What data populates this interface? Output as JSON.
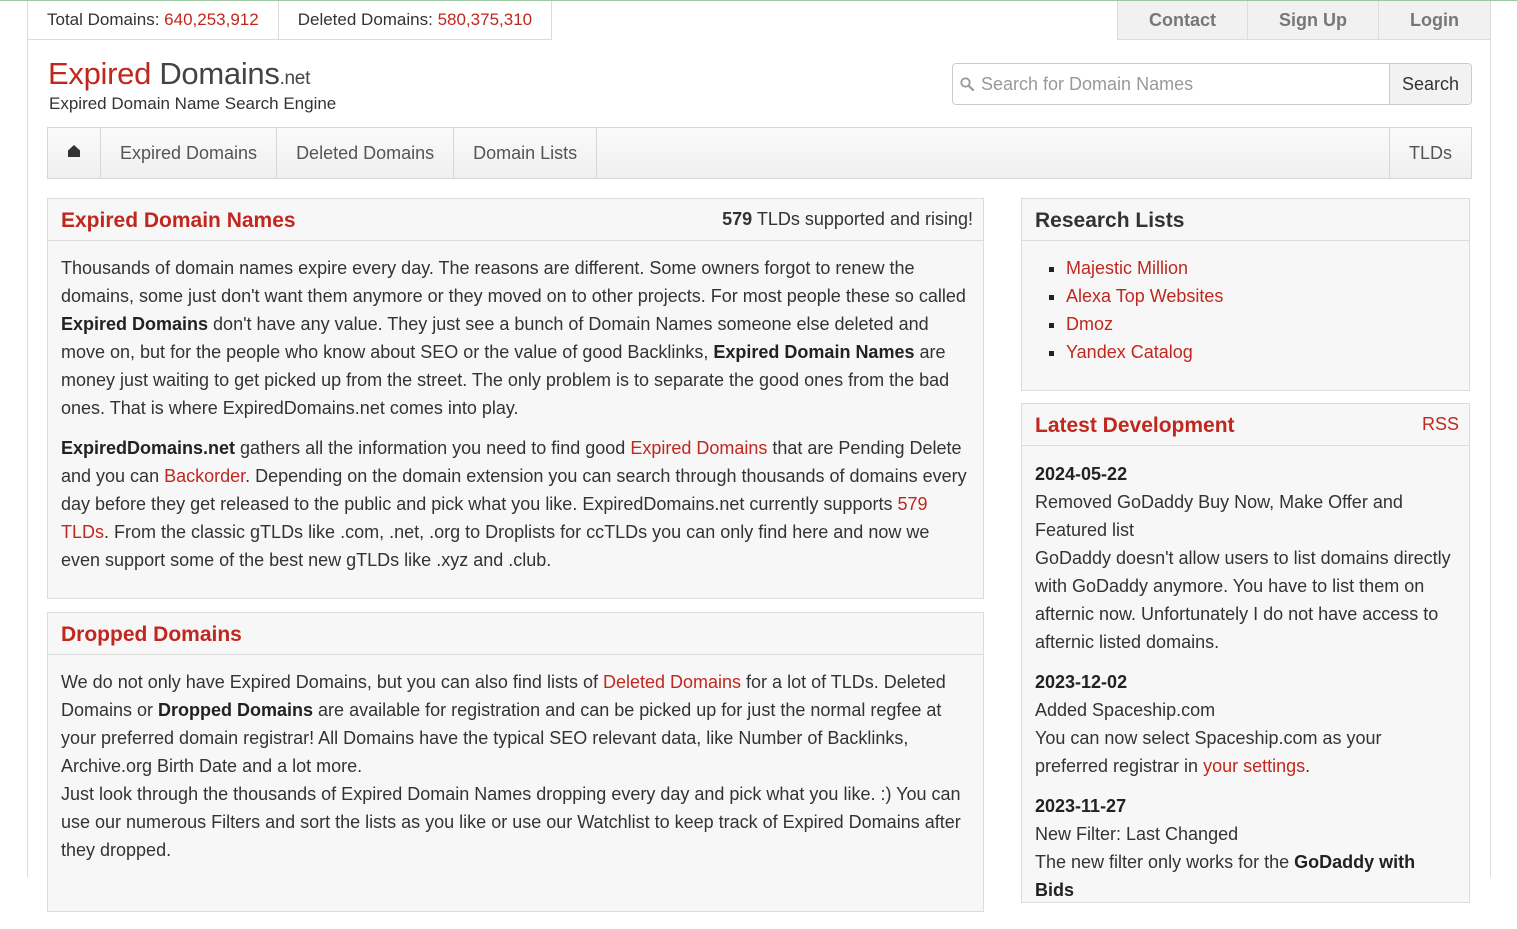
{
  "stats": {
    "total_label": "Total Domains:",
    "total_value": "640,253,912",
    "deleted_label": "Deleted Domains:",
    "deleted_value": "580,375,310"
  },
  "topnav": {
    "contact": "Contact",
    "signup": "Sign Up",
    "login": "Login"
  },
  "logo": {
    "expired": "Expired",
    "domains": " Domains",
    "net": ".net",
    "tagline": "Expired Domain Name Search Engine"
  },
  "search": {
    "placeholder": "Search for Domain Names",
    "button": "Search",
    "icon": "search-icon"
  },
  "mainnav": {
    "home_icon": "home-icon",
    "items": [
      "Expired Domains",
      "Deleted Domains",
      "Domain Lists"
    ],
    "tlds": "TLDs"
  },
  "expired_panel": {
    "title": "Expired Domain Names",
    "tld_count": "579",
    "tld_text": " TLDs supported and rising!",
    "p1": [
      "Thousands of domain names expire every day. The reasons are different. Some owners forgot to renew the domains, some just don't want them anymore or they moved on to other projects. For most people these so called ",
      "Expired Domains",
      " don't have any value. They just see a bunch of Domain Names someone else deleted and move on, but for the people who know about SEO or the value of good Backlinks, ",
      "Expired Domain Names",
      " are money just waiting to get picked up from the street. The only problem is to separate the good ones from the bad ones. That is where ExpiredDomains.net comes into play."
    ],
    "p2": [
      "ExpiredDomains.net",
      " gathers all the information you need to find good ",
      "Expired Domains",
      " that are Pending Delete and you can ",
      "Backorder",
      ". Depending on the domain extension you can search through thousands of domains every day before they get released to the public and pick what you like. ExpiredDomains.net currently supports ",
      "579 TLDs",
      ". From the classic gTLDs like .com, .net, .org to Droplists for ccTLDs you can only find here and now we even support some of the best new gTLDs like .xyz and .club."
    ]
  },
  "dropped_panel": {
    "title": "Dropped Domains",
    "p1": [
      "We do not only have Expired Domains, but you can also find lists of ",
      "Deleted Domains",
      " for a lot of TLDs. Deleted Domains or ",
      "Dropped Domains",
      " are available for registration and can be picked up for just the normal regfee at your preferred domain registrar! All Domains have the typical SEO relevant data, like Number of Backlinks, Archive.org Birth Date and a lot more."
    ],
    "p2": "Just look through the thousands of Expired Domain Names dropping every day and pick what you like. :) You can use our numerous Filters and sort the lists as you like or use our Watchlist to keep track of Expired Domains after they dropped."
  },
  "research": {
    "title": "Research Lists",
    "items": [
      "Majestic Million",
      "Alexa Top Websites",
      "Dmoz",
      "Yandex Catalog"
    ]
  },
  "latest": {
    "title": "Latest Development",
    "rss": "RSS",
    "entries": [
      {
        "date": "2024-05-22",
        "headline": "Removed GoDaddy Buy Now, Make Offer and Featured list",
        "text": "GoDaddy doesn't allow users to list domains directly with GoDaddy anymore. You have to list them on afternic now. Unfortunately I do not have access to afternic listed domains."
      },
      {
        "date": "2023-12-02",
        "headline": "Added Spaceship.com",
        "text": "You can now select Spaceship.com as your preferred registrar in ",
        "link": "your settings",
        "text_end": "."
      },
      {
        "date": "2023-11-27",
        "headline": "New Filter: Last Changed",
        "text": "The new filter only works for the ",
        "bold": "GoDaddy with Bids"
      }
    ]
  },
  "colors": {
    "accent": "#c0281f",
    "panel_bg": "#f7f7f7",
    "border": "#dcdcdc"
  }
}
